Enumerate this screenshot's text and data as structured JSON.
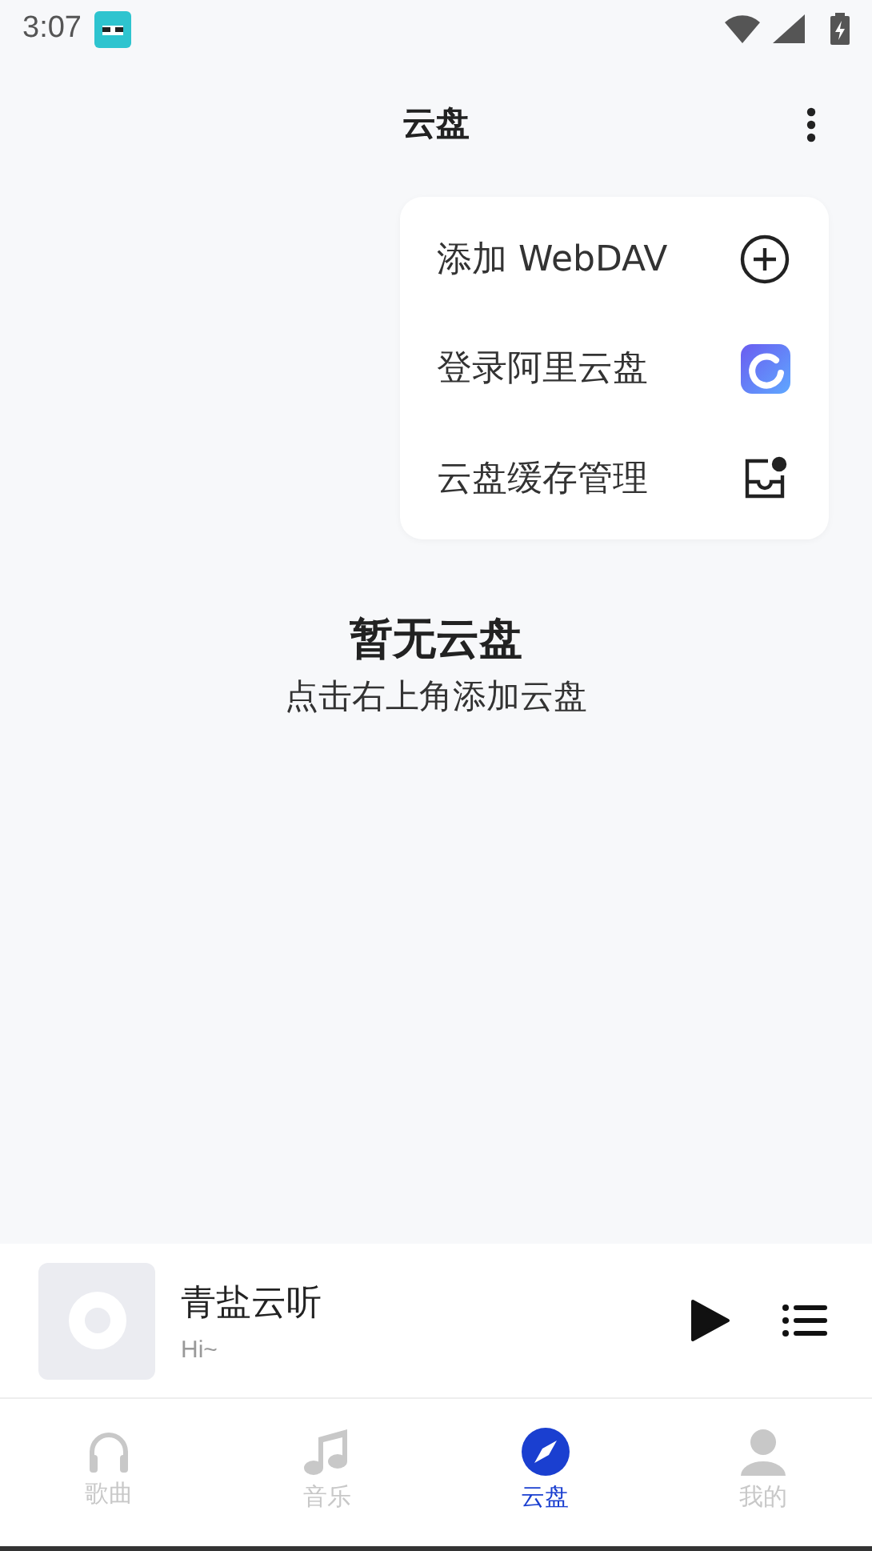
{
  "status_bar": {
    "time": "3:07"
  },
  "header": {
    "title": "云盘"
  },
  "menu": {
    "items": [
      {
        "label": "添加 WebDAV",
        "kind": "add"
      },
      {
        "label": "登录阿里云盘",
        "kind": "cloud"
      },
      {
        "label": "云盘缓存管理",
        "kind": "cache"
      }
    ]
  },
  "empty_state": {
    "title": "暂无云盘",
    "hint": "点击右上角添加云盘"
  },
  "player": {
    "title": "青盐云听",
    "subtitle": "Hi~"
  },
  "tabs": [
    {
      "label": "歌曲",
      "kind": "headphones",
      "selected": false
    },
    {
      "label": "音乐",
      "kind": "music",
      "selected": false
    },
    {
      "label": "云盘",
      "kind": "compass",
      "selected": true
    },
    {
      "label": "我的",
      "kind": "person",
      "selected": false
    }
  ]
}
